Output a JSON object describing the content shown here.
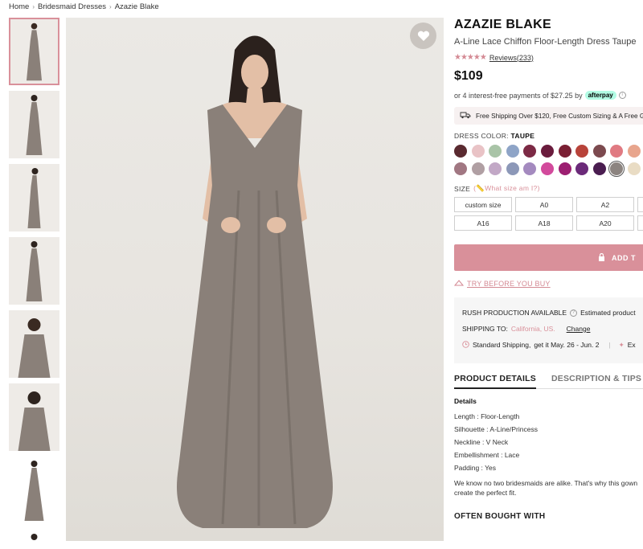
{
  "breadcrumb": [
    "Home",
    "Bridesmaid Dresses",
    "Azazie Blake"
  ],
  "product": {
    "brand": "AZAZIE BLAKE",
    "subtitle": "A-Line Lace Chiffon Floor-Length Dress Taupe",
    "rating_stars": 4.5,
    "reviews_label": "Reviews(233)",
    "price": "$109",
    "installments": "or 4 interest-free payments of $27.25 by",
    "afterpay_label": "afterpay",
    "shipping_banner": "Free Shipping Over $120, Free Custom Sizing & A Free G"
  },
  "color": {
    "label": "DRESS COLOR:",
    "selected": "TAUPE",
    "swatches": [
      "#5a2a30",
      "#e9c3c6",
      "#a9c4a7",
      "#8ea4c7",
      "#7c2a45",
      "#6a1c3d",
      "#7a1f33",
      "#b8433a",
      "#7c4a4f",
      "#e07a82",
      "#e8a58d",
      "#a17782",
      "#b09fa3",
      "#c2a8c6",
      "#8c98b8",
      "#a48abf",
      "#d24a9c",
      "#9c1f71",
      "#6b2a79",
      "#4a1d50",
      "#8c8480",
      "#e9dcc4"
    ],
    "selected_index": 20
  },
  "size": {
    "label": "SIZE",
    "help": "What size am I?",
    "options": [
      "custom size",
      "A0",
      "A2",
      "",
      "A16",
      "A18",
      "A20",
      ""
    ]
  },
  "cart": {
    "add_label": "ADD T"
  },
  "try_before": "TRY BEFORE YOU BUY",
  "shipping": {
    "rush": "RUSH PRODUCTION AVAILABLE",
    "estimated": "Estimated product",
    "ship_to_label": "SHIPPING TO:",
    "ship_to_value": "California, US.",
    "change": "Change",
    "standard": "Standard Shipping,",
    "get_it": "get it May. 26 - Jun. 2",
    "extra": "Ex"
  },
  "tabs": [
    "PRODUCT DETAILS",
    "DESCRIPTION & TIPS"
  ],
  "details": {
    "heading": "Details",
    "lines": [
      "Length : Floor-Length",
      "Silhouette : A-Line/Princess",
      "Neckline : V Neck",
      "Embellishment : Lace",
      "Padding : Yes"
    ],
    "blurb_1": "We know no two bridesmaids are alike. That's why this gown",
    "blurb_2": "create the perfect fit."
  },
  "often_bought": "OFTEN BOUGHT WITH",
  "colors": {
    "accent": "#d9909a",
    "dress": "#8a8079"
  }
}
